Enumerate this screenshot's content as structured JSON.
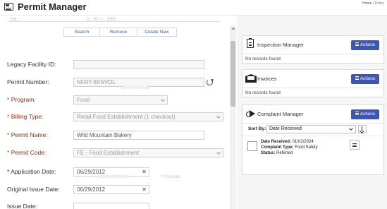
{
  "header": {
    "title": "Permit Manager",
    "links_home": "Home",
    "links_rest": "/ Policy"
  },
  "search_bar": {
    "clipped_left": "Ctrl...",
    "clipped_mid": "...D...(D...) ...EEE",
    "buttons": [
      "Search",
      "Remove",
      "Create New"
    ]
  },
  "form": {
    "legacy_facility_id": {
      "label": "Legacy Facility ID:",
      "value": ""
    },
    "permit_number": {
      "label": "Permit Number:",
      "value": "NFRY-8XNVDL"
    },
    "program": {
      "label": "Program:",
      "value": "Food"
    },
    "billing_type": {
      "label": "Billing Type:",
      "value": "Retail Food Establishment (1 checkout)"
    },
    "permit_name": {
      "label": "Permit Name:",
      "value": "Wild Mountain Bakery"
    },
    "permit_code": {
      "label": "Permit Code:",
      "value": "FE - Food Establishment"
    },
    "application_date": {
      "label": "Application Date:",
      "value": "06/29/2012"
    },
    "original_issue_date": {
      "label": "Original Issue Date:",
      "value": "06/29/2012"
    },
    "issue_date": {
      "label": "Issue Date:",
      "value": ""
    },
    "required_marker": "*",
    "ghost_label": "* Presents"
  },
  "panels": {
    "inspection": {
      "title": "Inspection Manager",
      "actions": "Actions",
      "empty": "No records found"
    },
    "invoices": {
      "title": "Invoices",
      "actions": "Actions",
      "empty": "No records found"
    },
    "complaint": {
      "title": "Complaint Manager",
      "actions": "Actions",
      "sort_label": "Sort By:",
      "sort_value": "Date Received",
      "item": {
        "date_label": "Date Received:",
        "date_value": "01/02/2024",
        "type_label": "Complaint Type:",
        "type_value": "Food Safety",
        "status_label": "Status:",
        "status_value": "Referred"
      }
    }
  },
  "colors": {
    "accent": "#3f55b4",
    "required": "#8b2f14",
    "link": "#3b62a8"
  }
}
